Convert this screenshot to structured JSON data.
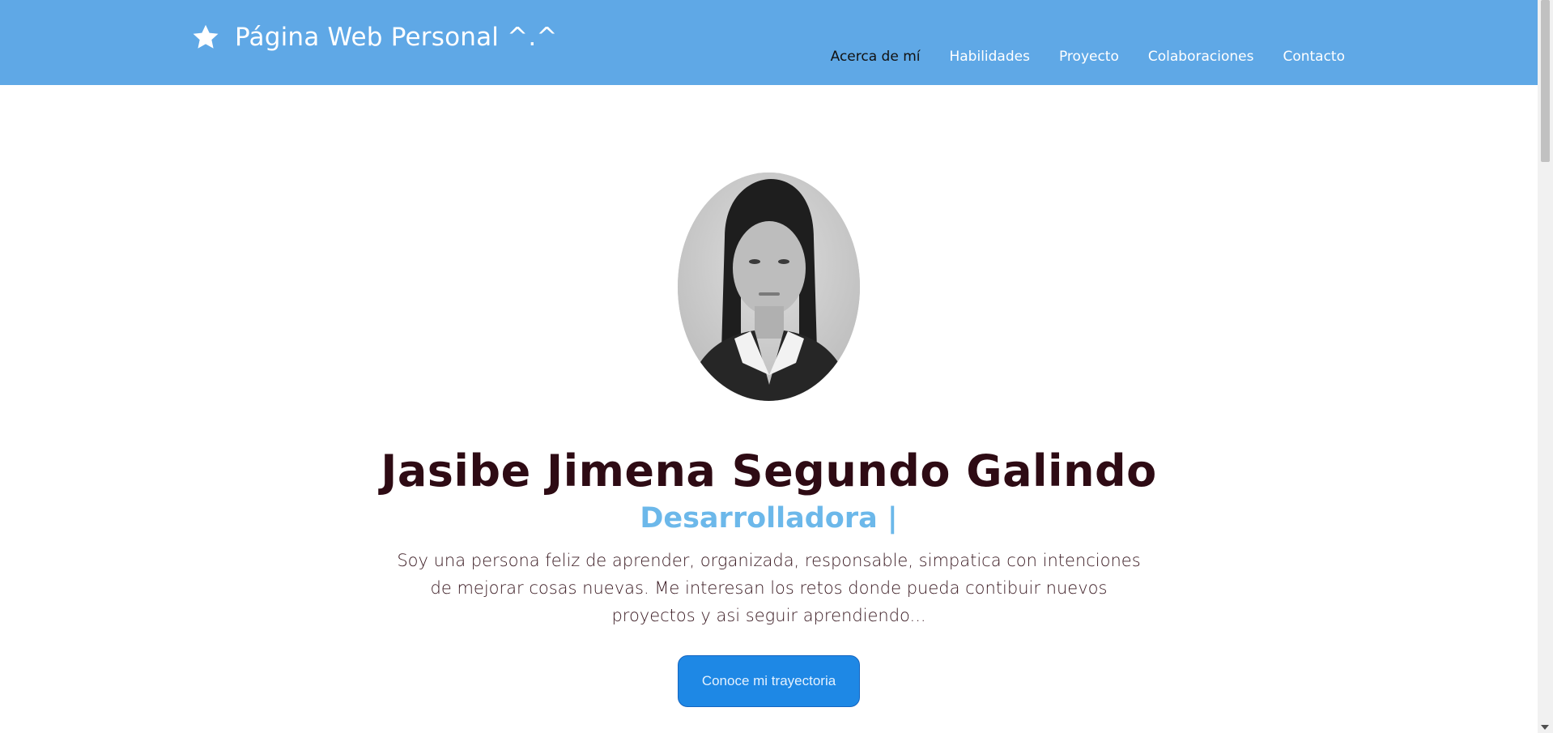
{
  "colors": {
    "navbar": "#5fa8e6",
    "name": "#2e0b14",
    "role": "#6cb8ea",
    "button": "#1e88e5"
  },
  "brand": {
    "icon": "star-icon",
    "title": "Página Web Personal ^.^"
  },
  "nav": {
    "items": [
      {
        "label": "Acerca de mí",
        "active": true
      },
      {
        "label": "Habilidades",
        "active": false
      },
      {
        "label": "Proyecto",
        "active": false
      },
      {
        "label": "Colaboraciones",
        "active": false
      },
      {
        "label": "Contacto",
        "active": false
      }
    ]
  },
  "hero": {
    "name": "Jasibe Jimena Segundo Galindo",
    "role": "Desarrolladora |",
    "bio": "Soy una persona feliz de aprender, organizada, responsable, simpatica con intenciones de mejorar cosas nuevas. Me interesan los retos donde pueda contibuir nuevos proyectos y asi seguir aprendiendo...",
    "cta_label": "Conoce mi trayectoria"
  }
}
